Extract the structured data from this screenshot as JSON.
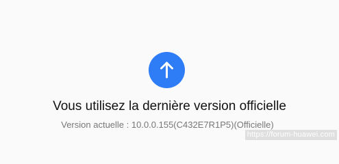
{
  "update_status": {
    "icon": "arrow-up-icon",
    "title": "Vous utilisez la dernière version officielle",
    "version_line": "Version actuelle : 10.0.0.155(C432E7R1P5)(Officielle)"
  },
  "watermark": {
    "text": "https://forum-huawei.com"
  },
  "colors": {
    "accent": "#2e7cf6",
    "title_text": "#111111",
    "secondary_text": "#777777",
    "background": "#fafafa"
  }
}
